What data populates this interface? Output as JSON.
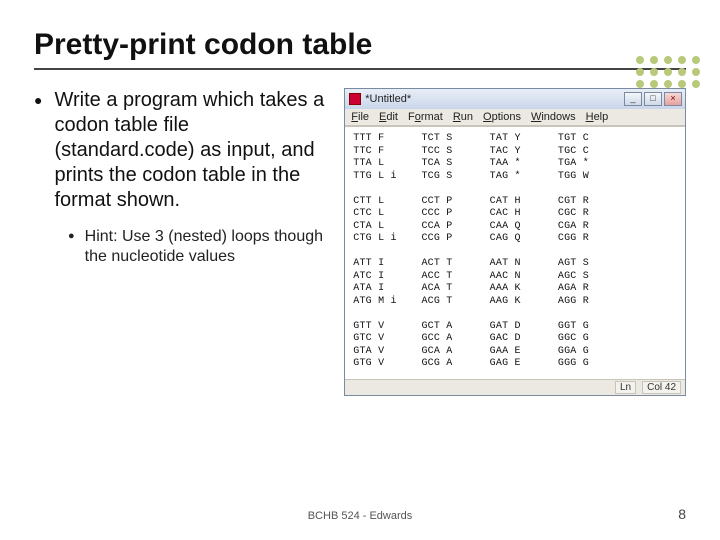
{
  "title": "Pretty-print codon table",
  "bullet_main": "Write a program which takes a codon table file (standard.code) as input, and prints the codon table in the format shown.",
  "bullet_sub": "Hint: Use 3 (nested) loops though the nucleotide values",
  "footer_center": "BCHB 524 - Edwards",
  "footer_page": "8",
  "window": {
    "title": "*Untitled*",
    "menus": {
      "file": "File",
      "edit": "Edit",
      "format": "Format",
      "run": "Run",
      "options": "Options",
      "windows": "Windows",
      "help": "Help"
    },
    "btn_min": "_",
    "btn_max": "□",
    "btn_close": "×",
    "status_ln": "Ln",
    "status_col": "Col 42"
  },
  "codon_text": "TTT F      TCT S      TAT Y      TGT C\nTTC F      TCC S      TAC Y      TGC C\nTTA L      TCA S      TAA *      TGA *\nTTG L i    TCG S      TAG *      TGG W\n\nCTT L      CCT P      CAT H      CGT R\nCTC L      CCC P      CAC H      CGC R\nCTA L      CCA P      CAA Q      CGA R\nCTG L i    CCG P      CAG Q      CGG R\n\nATT I      ACT T      AAT N      AGT S\nATC I      ACC T      AAC N      AGC S\nATA I      ACA T      AAA K      AGA R\nATG M i    ACG T      AAG K      AGG R\n\nGTT V      GCT A      GAT D      GGT G\nGTC V      GCC A      GAC D      GGC G\nGTA V      GCA A      GAA E      GGA G\nGTG V      GCG A      GAG E      GGG G"
}
